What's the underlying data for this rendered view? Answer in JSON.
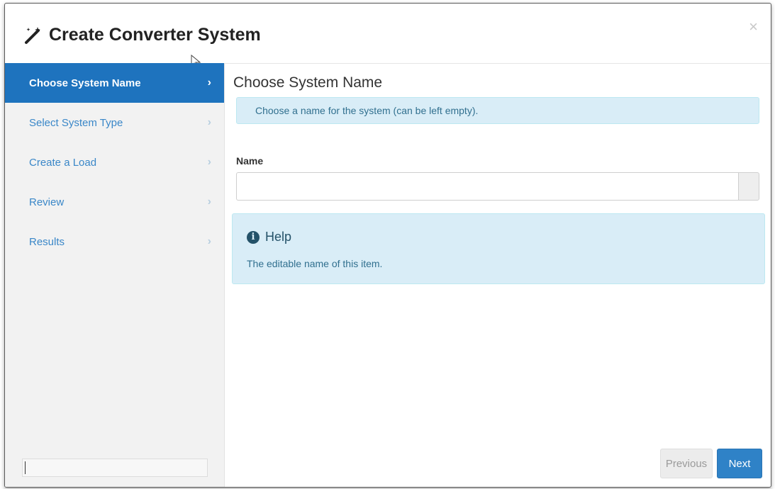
{
  "dialog": {
    "title": "Create Converter System",
    "title_icon": "magic-wand-icon",
    "close_label": "×"
  },
  "sidebar": {
    "items": [
      {
        "label": "Choose System Name",
        "chevron": "›",
        "active": true
      },
      {
        "label": "Select System Type",
        "chevron": "›",
        "active": false
      },
      {
        "label": "Create a Load",
        "chevron": "›",
        "active": false
      },
      {
        "label": "Review",
        "chevron": "›",
        "active": false
      },
      {
        "label": "Results",
        "chevron": "›",
        "active": false
      }
    ]
  },
  "main": {
    "step_title": "Choose System Name",
    "info_text": "Choose a name for the system (can be left empty).",
    "name_label": "Name",
    "name_value": "",
    "help": {
      "title": "Help",
      "icon": "info-icon",
      "text": "The editable name of this item."
    }
  },
  "footer": {
    "previous_label": "Previous",
    "next_label": "Next"
  },
  "colors": {
    "accent": "#1e73be",
    "info_bg": "#d9edf7",
    "info_text": "#31708f",
    "sidebar_bg": "#f2f2f2"
  }
}
